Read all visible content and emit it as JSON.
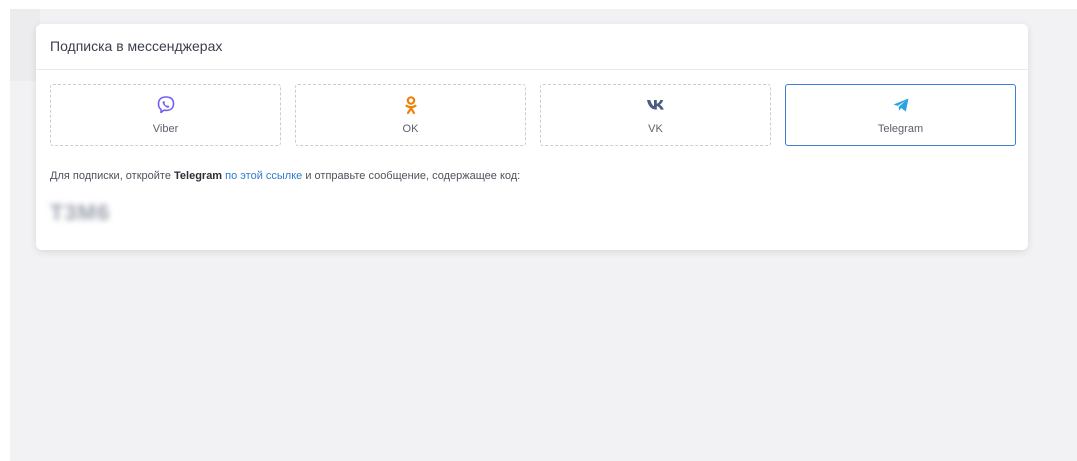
{
  "card": {
    "title": "Подписка в мессенджерах"
  },
  "messengers": [
    {
      "label": "Viber",
      "icon": "viber-icon",
      "color": "#7360f2",
      "selected": false
    },
    {
      "label": "OK",
      "icon": "ok-icon",
      "color": "#ee8208",
      "selected": false
    },
    {
      "label": "VK",
      "icon": "vk-icon",
      "color": "#4a5d80",
      "selected": false
    },
    {
      "label": "Telegram",
      "icon": "telegram-icon",
      "color": "#2aa3e0",
      "selected": true
    }
  ],
  "instruction": {
    "prefix": "Для подписки, откройте ",
    "app": "Telegram",
    "link": "по этой ссылке",
    "suffix": " и отправьте сообщение, содержащее код:"
  },
  "code": {
    "value": "T3M6"
  },
  "colors": {
    "selected_border": "#3d7fd0",
    "link": "#2f7bd0",
    "page_background": "#f2f2f5"
  }
}
